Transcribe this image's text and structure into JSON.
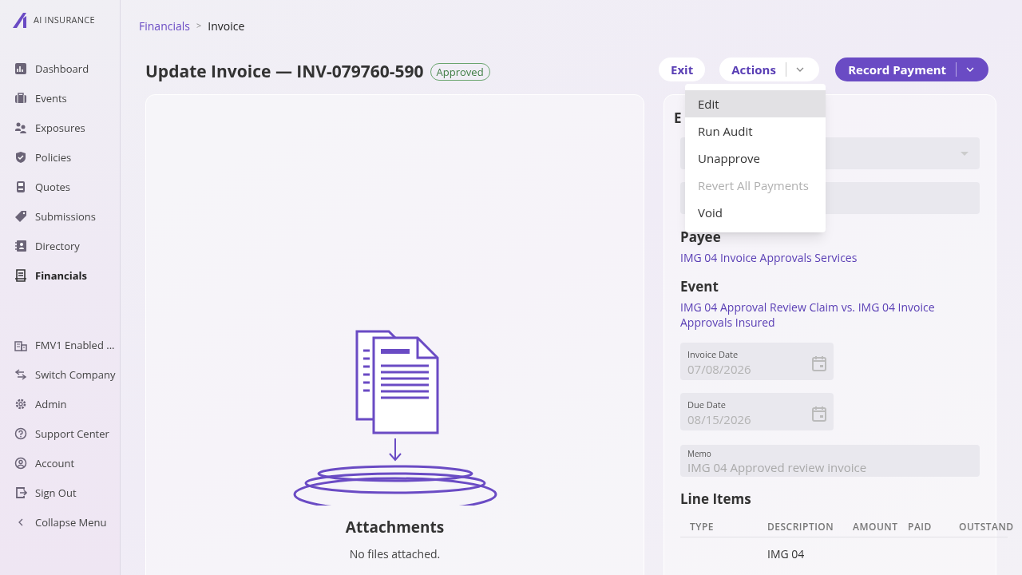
{
  "logo": {
    "text": "AI INSURANCE"
  },
  "sidebar": {
    "items": [
      {
        "label": "Dashboard",
        "selected": false
      },
      {
        "label": "Events",
        "selected": false
      },
      {
        "label": "Exposures",
        "selected": false
      },
      {
        "label": "Policies",
        "selected": false
      },
      {
        "label": "Quotes",
        "selected": false
      },
      {
        "label": "Submissions",
        "selected": false
      },
      {
        "label": "Directory",
        "selected": false
      },
      {
        "label": "Financials",
        "selected": true
      }
    ],
    "bottom_items": [
      {
        "label": "FMV1 Enabled ..."
      },
      {
        "label": "Switch Company"
      },
      {
        "label": "Admin"
      },
      {
        "label": "Support Center"
      },
      {
        "label": "Account"
      },
      {
        "label": "Sign Out"
      },
      {
        "label": "Collapse Menu"
      }
    ]
  },
  "breadcrumb": [
    {
      "label": "Financials",
      "link": true
    },
    {
      "label": "Invoice",
      "link": false
    }
  ],
  "breadcrumb_separator": ">",
  "title": "Update Invoice — INV-079760-590",
  "status_badge": "Approved",
  "buttons": {
    "exit": "Exit",
    "actions": "Actions",
    "record_payment": "Record Payment"
  },
  "actions_menu": [
    {
      "label": "Edit",
      "selected": true,
      "disabled": false
    },
    {
      "label": "Run Audit",
      "selected": false,
      "disabled": false
    },
    {
      "label": "Unapprove",
      "selected": false,
      "disabled": false
    },
    {
      "label": "Revert All Payments",
      "selected": false,
      "disabled": true
    },
    {
      "label": "Void",
      "selected": false,
      "disabled": false
    }
  ],
  "attachments": {
    "title": "Attachments",
    "empty_text": "No files attached."
  },
  "details": {
    "section_heading": "E",
    "payee_label": "Payee",
    "payee": "IMG 04 Invoice Approvals Services",
    "event_label": "Event",
    "event": "IMG 04 Approval Review Claim vs. IMG 04 Invoice Approvals Insured",
    "invoice_date": {
      "label": "Invoice Date",
      "value": "07/08/2026"
    },
    "due_date": {
      "label": "Due Date",
      "value": "08/15/2026"
    },
    "memo": {
      "label": "Memo",
      "value": "IMG 04 Approved review invoice"
    }
  },
  "line_items": {
    "title": "Line Items",
    "columns": [
      "TYPE",
      "DESCRIPTION",
      "AMOUNT",
      "PAID",
      "OUTSTAND"
    ],
    "rows": [
      [
        "",
        "IMG 04",
        "",
        "",
        ""
      ]
    ]
  }
}
